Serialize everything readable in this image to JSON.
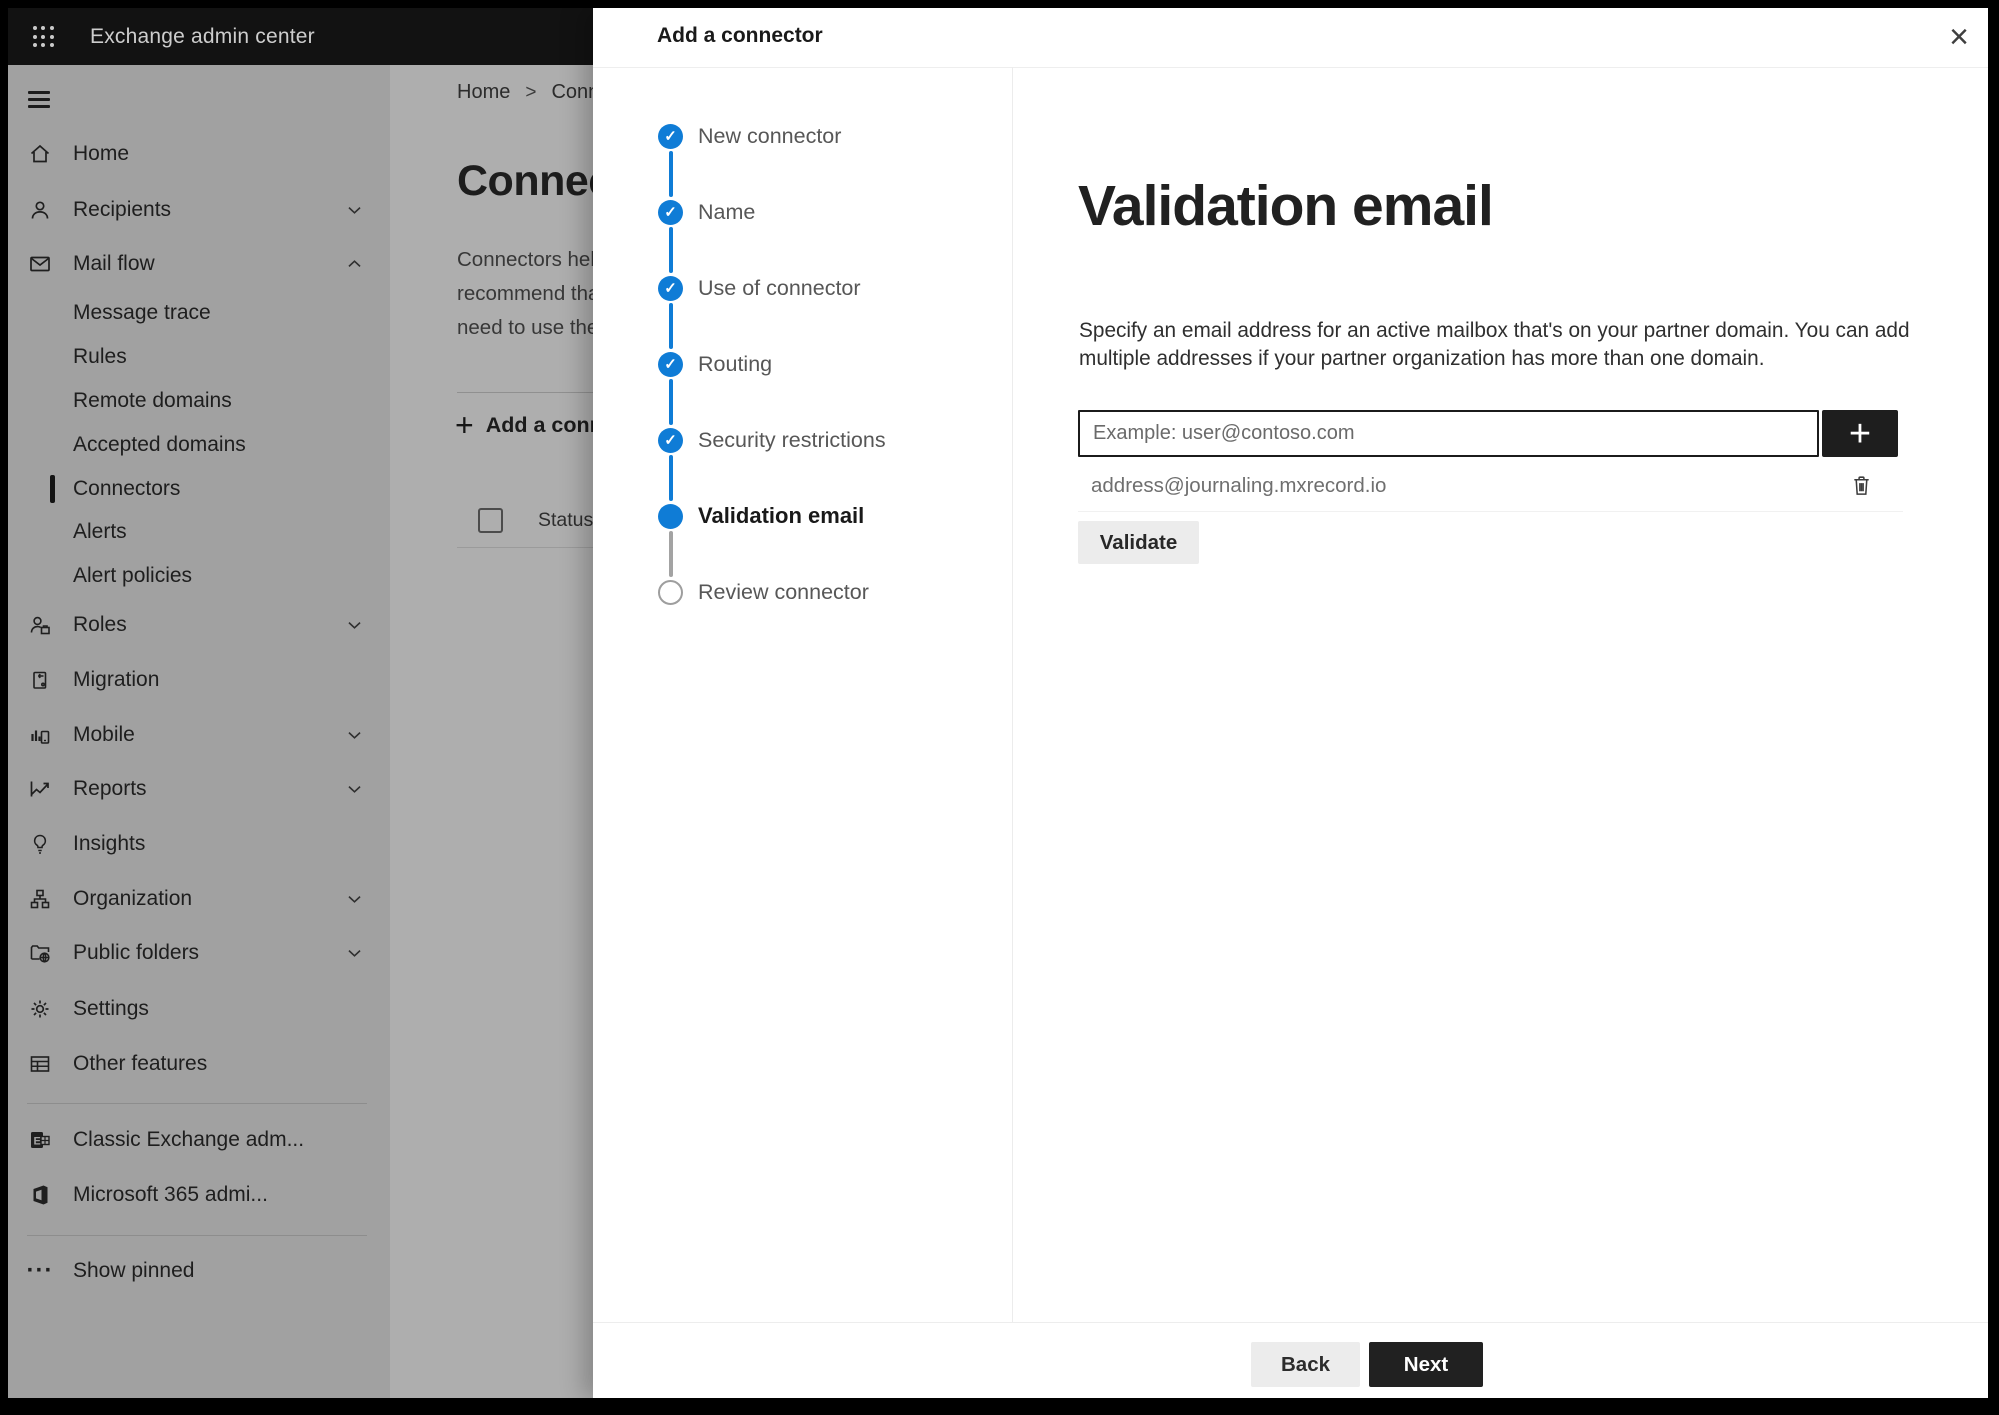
{
  "chrome": {
    "topbar_title": "Exchange admin center"
  },
  "icons": {
    "close": "×",
    "plus": "+",
    "check": "✓",
    "ellipsis": "···"
  },
  "colors": {
    "accent_blue": "#0f7cd6",
    "dark_button": "#212121",
    "topbar": "#121212"
  },
  "sidebar": {
    "items": [
      {
        "label": "Home",
        "icon": "home-icon"
      },
      {
        "label": "Recipients",
        "icon": "person-icon",
        "chevron": "down"
      },
      {
        "label": "Mail flow",
        "icon": "mail-icon",
        "chevron": "up"
      },
      {
        "label": "Message trace",
        "indent": true
      },
      {
        "label": "Rules",
        "indent": true
      },
      {
        "label": "Remote domains",
        "indent": true
      },
      {
        "label": "Accepted domains",
        "indent": true
      },
      {
        "label": "Connectors",
        "indent": true,
        "selected": true
      },
      {
        "label": "Alerts",
        "indent": true
      },
      {
        "label": "Alert policies",
        "indent": true
      },
      {
        "label": "Roles",
        "icon": "roles-icon",
        "chevron": "down"
      },
      {
        "label": "Migration",
        "icon": "migration-icon"
      },
      {
        "label": "Mobile",
        "icon": "mobile-icon",
        "chevron": "down"
      },
      {
        "label": "Reports",
        "icon": "reports-icon",
        "chevron": "down"
      },
      {
        "label": "Insights",
        "icon": "insights-icon"
      },
      {
        "label": "Organization",
        "icon": "organization-icon",
        "chevron": "down"
      },
      {
        "label": "Public folders",
        "icon": "public-folders-icon",
        "chevron": "down"
      },
      {
        "label": "Settings",
        "icon": "settings-icon"
      },
      {
        "label": "Other features",
        "icon": "other-features-icon"
      },
      {
        "divider": true
      },
      {
        "label": "Classic Exchange adm...",
        "icon": "classic-exchange-icon"
      },
      {
        "label": "Microsoft 365 admi...",
        "icon": "microsoft-365-icon"
      },
      {
        "divider": true
      },
      {
        "label": "Show pinned",
        "icon": "ellipsis-icon"
      }
    ]
  },
  "background_page": {
    "breadcrumb": {
      "home": "Home",
      "separator": ">",
      "current": "Conne"
    },
    "title": "Connec",
    "description_lines": [
      "Connectors help",
      "recommend tha",
      "need to use ther"
    ],
    "add_button_label": "Add a conn",
    "table_header": "Status"
  },
  "panel": {
    "title": "Add a connector",
    "steps": [
      {
        "label": "New connector",
        "state": "done"
      },
      {
        "label": "Name",
        "state": "done"
      },
      {
        "label": "Use of connector",
        "state": "done"
      },
      {
        "label": "Routing",
        "state": "done"
      },
      {
        "label": "Security restrictions",
        "state": "done"
      },
      {
        "label": "Validation email",
        "state": "current"
      },
      {
        "label": "Review connector",
        "state": "todo"
      }
    ],
    "content": {
      "heading": "Validation email",
      "desc_lines": [
        "Specify an email address for an active mailbox that's on your partner domain. You can add",
        "multiple addresses if your partner organization has more than one domain."
      ],
      "email_input_placeholder": "Example: user@contoso.com",
      "email_input_value": "",
      "added_addresses": [
        "address@journaling.mxrecord.io"
      ],
      "validate_button": "Validate"
    },
    "footer": {
      "back_button": "Back",
      "next_button": "Next"
    }
  }
}
